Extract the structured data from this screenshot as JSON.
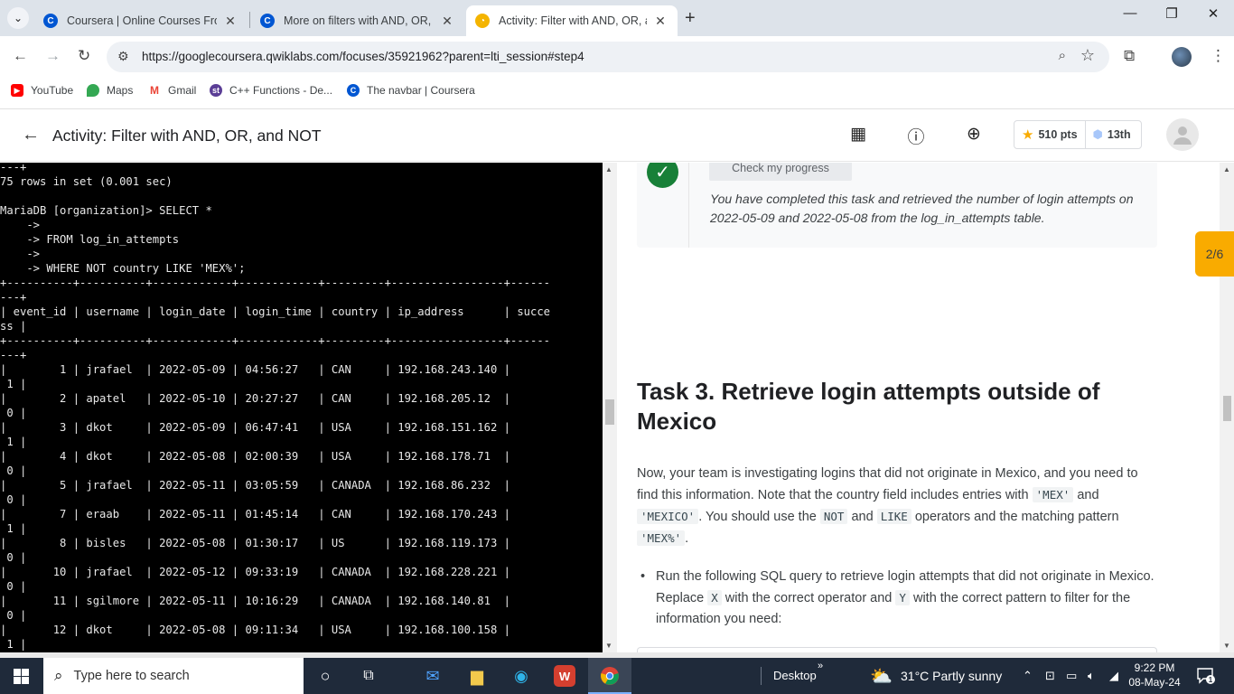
{
  "browser": {
    "tabs": [
      {
        "title": "Coursera | Online Courses From",
        "favicon": "coursera-icon"
      },
      {
        "title": "More on filters with AND, OR, a",
        "favicon": "coursera-icon"
      },
      {
        "title": "Activity: Filter with AND, OR, an",
        "favicon": "qwiklabs-icon",
        "active": true
      }
    ],
    "url": "https://googlecoursera.qwiklabs.com/focuses/35921962?parent=lti_session#step4",
    "bookmarks": [
      {
        "label": "YouTube",
        "icon": "youtube-icon"
      },
      {
        "label": "Maps",
        "icon": "maps-icon"
      },
      {
        "label": "Gmail",
        "icon": "gmail-icon"
      },
      {
        "label": "C++ Functions - De...",
        "icon": "studytonight-icon"
      },
      {
        "label": "The navbar | Coursera",
        "icon": "coursera-icon"
      }
    ]
  },
  "header": {
    "title": "Activity: Filter with AND, OR, and NOT",
    "points": "510 pts",
    "rank": "13th"
  },
  "terminal": {
    "text": "---+\n75 rows in set (0.001 sec)\n\nMariaDB [organization]> SELECT *\n    ->\n    -> FROM log_in_attempts\n    ->\n    -> WHERE NOT country LIKE 'MEX%';\n+----------+----------+------------+------------+---------+-----------------+------\n---+\n| event_id | username | login_date | login_time | country | ip_address      | succe\nss |\n+----------+----------+------------+------------+---------+-----------------+------\n---+\n|        1 | jrafael  | 2022-05-09 | 04:56:27   | CAN     | 192.168.243.140 |\n 1 |\n|        2 | apatel   | 2022-05-10 | 20:27:27   | CAN     | 192.168.205.12  |\n 0 |\n|        3 | dkot     | 2022-05-09 | 06:47:41   | USA     | 192.168.151.162 |\n 1 |\n|        4 | dkot     | 2022-05-08 | 02:00:39   | USA     | 192.168.178.71  |\n 0 |\n|        5 | jrafael  | 2022-05-11 | 03:05:59   | CANADA  | 192.168.86.232  |\n 0 |\n|        7 | eraab    | 2022-05-11 | 01:45:14   | CAN     | 192.168.170.243 |\n 1 |\n|        8 | bisles   | 2022-05-08 | 01:30:17   | US      | 192.168.119.173 |\n 0 |\n|       10 | jrafael  | 2022-05-12 | 09:33:19   | CANADA  | 192.168.228.221 |\n 0 |\n|       11 | sgilmore | 2022-05-11 | 10:16:29   | CANADA  | 192.168.140.81  |\n 0 |\n|       12 | dkot     | 2022-05-08 | 09:11:34   | USA     | 192.168.100.158 |\n 1 |"
  },
  "panel": {
    "progress_button": "Check my progress",
    "done_text": "You have completed this task and retrieved the number of login attempts on 2022-05-09 and 2022-05-08 from the log_in_attempts table.",
    "task_title": "Task 3. Retrieve login attempts outside of Mexico",
    "para": {
      "t1": "Now, your team is investigating logins that did not originate in Mexico, and you need to find this information. Note that the country field includes entries with ",
      "c1": "'MEX'",
      "t2": " and ",
      "c2": "'MEXICO'",
      "t3": ". You should use the ",
      "c3": "NOT",
      "t4": " and ",
      "c4": "LIKE",
      "t5": " operators and the matching pattern ",
      "c5": "'MEX%'",
      "t6": "."
    },
    "bullet": {
      "t1": "Run the following SQL query to retrieve login attempts that did not originate in Mexico. Replace ",
      "c1": "X",
      "t2": " with the correct operator and ",
      "c2": "Y",
      "t3": " with the correct pattern to filter for the information you need:"
    },
    "step_badge": "2/6"
  },
  "taskbar": {
    "search_placeholder": "Type here to search",
    "desktop_label": "Desktop",
    "weather": "31°C  Partly sunny",
    "time": "9:22 PM",
    "date": "08-May-24",
    "notification_count": "1"
  },
  "colors": {
    "terminal_bg": "#000000",
    "success_green": "#188038",
    "step_badge": "#f9ab00",
    "taskbar": "#1f2a3a"
  }
}
